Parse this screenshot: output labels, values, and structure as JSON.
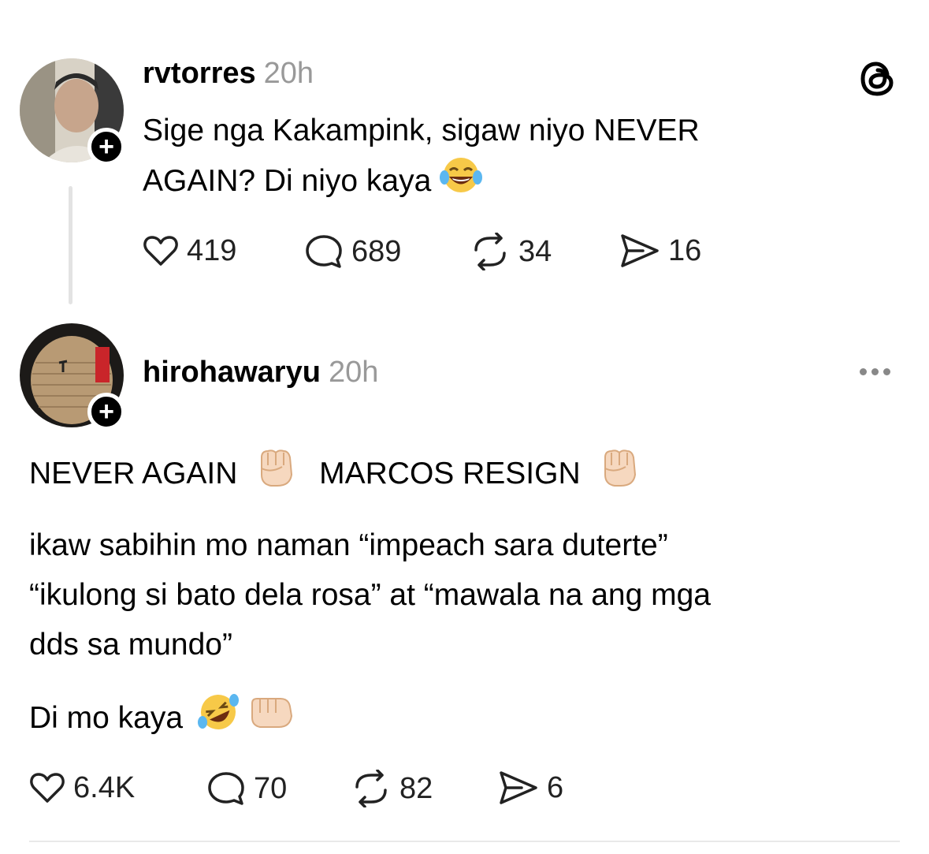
{
  "post1": {
    "username": "rvtorres",
    "time": "20h",
    "text_line1": "Sige nga Kakampink, sigaw niyo NEVER",
    "text_line2": "AGAIN? Di niyo kaya",
    "emoji": "face-with-tears-of-joy",
    "likes": "419",
    "replies": "689",
    "reposts": "34",
    "shares": "16",
    "follow_label": "+"
  },
  "post2": {
    "username": "hirohawaryu",
    "time": "20h",
    "line1_a": "NEVER AGAIN",
    "line1_b": "MARCOS RESIGN",
    "para2_line1": "ikaw sabihin mo naman “impeach sara duterte”",
    "para2_line2": "“ikulong si bato dela rosa” at “mawala na ang mga",
    "para2_line3": "dds sa mundo”",
    "para3": "Di mo kaya",
    "likes": "6.4K",
    "replies": "70",
    "reposts": "82",
    "shares": "6",
    "follow_label": "+"
  },
  "icons": [
    "threads-logo-icon",
    "heart-icon",
    "reply-icon",
    "repost-icon",
    "send-icon",
    "more-options-icon",
    "raised-fist-emoji",
    "rolling-laughing-emoji",
    "pointing-fist-emoji"
  ]
}
